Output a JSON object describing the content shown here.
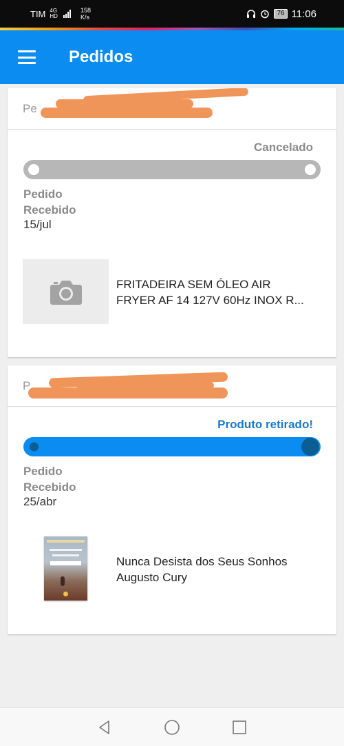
{
  "status_bar": {
    "carrier": "TIM",
    "network_top": "4G",
    "network_bottom": "HD",
    "speed_value": "158",
    "speed_unit": "K/s",
    "battery": "76",
    "time": "11:06"
  },
  "app_bar": {
    "title": "Pedidos"
  },
  "orders": [
    {
      "id_label": "Pe",
      "status": "Cancelado",
      "step_label_line1": "Pedido",
      "step_label_line2": "Recebido",
      "step_date": "15/jul",
      "product_line1": "FRITADEIRA SEM ÓLEO AIR",
      "product_line2": "FRYER AF 14 127V 60Hz INOX R..."
    },
    {
      "id_label": "P",
      "status": "Produto retirado!",
      "step_label_line1": "Pedido",
      "step_label_line2": "Recebido",
      "step_date": "25/abr",
      "product_line1": "Nunca Desista dos Seus Sonhos",
      "product_line2": "Augusto Cury"
    }
  ],
  "colors": {
    "primary": "#0b8cf0",
    "status_done": "#1a78c8",
    "status_cancel": "#8a8a8a",
    "redaction": "#f0955a"
  }
}
